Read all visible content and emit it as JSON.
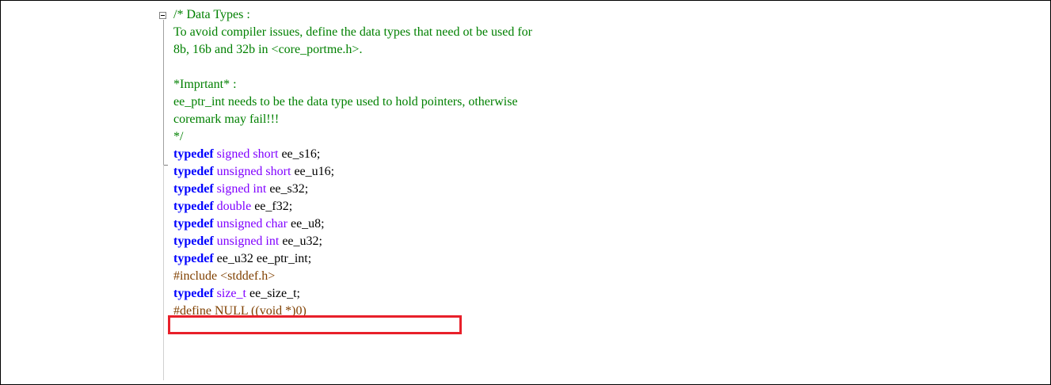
{
  "code": {
    "comment_lines": [
      "/* Data Types :",
      "       To avoid compiler issues, define the data types that need ot be used for",
      "   8b, 16b and 32b in <core_portme.h>.",
      "",
      "       *Imprtant* :",
      "       ee_ptr_int needs to be the data type used to hold pointers, otherwise",
      "   coremark may fail!!!",
      "*/"
    ],
    "typedefs": [
      {
        "keyword": "typedef",
        "type": "signed short",
        "pad": "   ",
        "name": "ee_s16;"
      },
      {
        "keyword": "typedef",
        "type": "unsigned short",
        "pad": " ",
        "name": "ee_u16;"
      },
      {
        "keyword": "typedef",
        "type": "signed int",
        "pad": "     ",
        "name": "ee_s32;"
      },
      {
        "keyword": "typedef",
        "type": "double",
        "pad": "         ",
        "name": "ee_f32;"
      },
      {
        "keyword": "typedef",
        "type": "unsigned char",
        "pad": "  ",
        "name": "ee_u8;"
      },
      {
        "keyword": "typedef",
        "type": "unsigned int",
        "pad": "   ",
        "name": "ee_u32;"
      },
      {
        "keyword": "typedef",
        "type": "ee_u32",
        "pad": "         ",
        "name": "ee_ptr_int;",
        "type_plain": true
      }
    ],
    "include_line": "#include <stddef.h>",
    "size_typedef": {
      "keyword": "typedef",
      "type": "size_t",
      "pad": "         ",
      "name": "ee_size_t;"
    },
    "define_line": "#define NULL ((void *)0)"
  },
  "colors": {
    "comment": "#008000",
    "keyword": "#0000ff",
    "type": "#8000ff",
    "preprocessor": "#804000",
    "highlight_box": "#e8202a"
  }
}
